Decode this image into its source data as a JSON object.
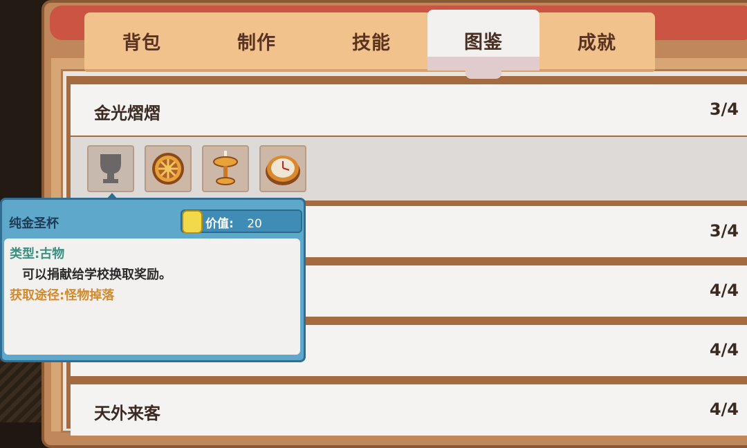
{
  "tabs": [
    {
      "label": "背包"
    },
    {
      "label": "制作"
    },
    {
      "label": "技能"
    },
    {
      "label": "图鉴",
      "active": true
    },
    {
      "label": "成就"
    }
  ],
  "collections": [
    {
      "title": "金光熠熠",
      "count": "3/4"
    },
    {
      "title": "",
      "count": "3/4"
    },
    {
      "title": "",
      "count": "4/4"
    },
    {
      "title": "",
      "count": "4/4"
    },
    {
      "title": "天外来客",
      "count": "4/4"
    }
  ],
  "items": [
    {
      "icon": "chalice-silhouette-icon",
      "discovered": false
    },
    {
      "icon": "golden-wheel-icon",
      "discovered": true
    },
    {
      "icon": "golden-candlestick-icon",
      "discovered": true
    },
    {
      "icon": "golden-clock-icon",
      "discovered": true
    }
  ],
  "tooltip": {
    "name": "纯金圣杯",
    "value_label": "价值:",
    "value": "20",
    "type": "类型:古物",
    "description": "可以捐献给学校换取奖励。",
    "source": "获取途径:怪物掉落"
  },
  "colors": {
    "tab_bar": "#f2c28c",
    "frame": "#c0875a",
    "tooltip": "#5ea8cc",
    "type_text": "#3a8f80",
    "source_text": "#d48a2a"
  }
}
